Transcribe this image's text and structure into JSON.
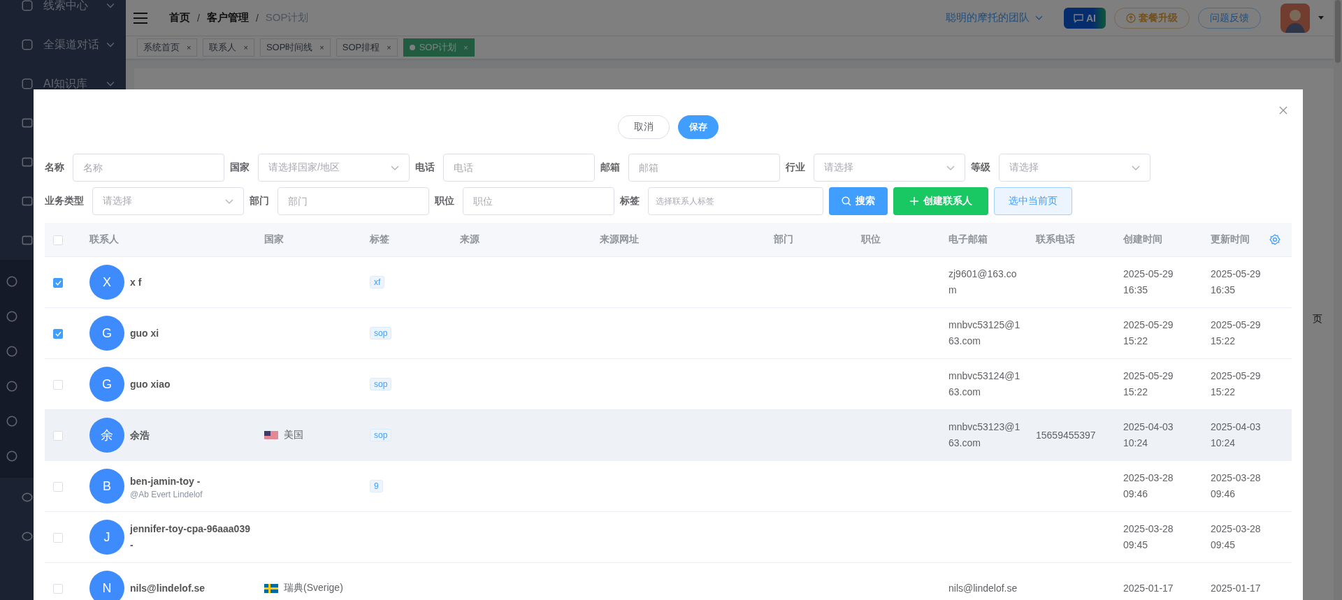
{
  "sidebar": {
    "items": [
      {
        "label": "线索中心"
      },
      {
        "label": "全渠道对话"
      },
      {
        "label": "AI知识库"
      }
    ]
  },
  "header": {
    "breadcrumb": [
      {
        "label": "首页",
        "current": false
      },
      {
        "separator": "/",
        "label": "客户管理",
        "current": false
      },
      {
        "separator": "/",
        "label": "SOP计划",
        "current": true
      }
    ],
    "team": "聪明的摩托的团队",
    "ai_button": "AI",
    "upgrade_button": "套餐升级",
    "feedback_button": "问题反馈"
  },
  "tabs": [
    {
      "label": "系统首页",
      "close": "×",
      "selected": false
    },
    {
      "label": "联系人",
      "close": "×",
      "selected": false
    },
    {
      "label": "SOP时间线",
      "close": "×",
      "selected": false
    },
    {
      "label": "SOP排程",
      "close": "×",
      "selected": false
    },
    {
      "label": "SOP计划",
      "close": "×",
      "selected": true
    }
  ],
  "background_text": "页",
  "modal": {
    "buttons": [
      {
        "label": "取消",
        "kind": "default"
      },
      {
        "label": "保存",
        "kind": "primary"
      }
    ],
    "filter_rows": [
      [
        {
          "label": "名称",
          "placeholder": "名称",
          "kind": "input"
        },
        {
          "label": "国家",
          "placeholder": "请选择国家/地区",
          "kind": "select"
        },
        {
          "label": "电话",
          "placeholder": "电话",
          "kind": "input"
        },
        {
          "label": "邮箱",
          "placeholder": "邮箱",
          "kind": "input"
        },
        {
          "label": "行业",
          "placeholder": "请选择",
          "kind": "select"
        },
        {
          "label": "等级",
          "placeholder": "请选择",
          "kind": "select"
        }
      ],
      [
        {
          "label": "业务类型",
          "placeholder": "请选择",
          "kind": "select"
        },
        {
          "label": "部门",
          "placeholder": "部门",
          "kind": "input"
        },
        {
          "label": "职位",
          "placeholder": "职位",
          "kind": "input"
        },
        {
          "label": "标签",
          "placeholder": "选择联系人标签",
          "kind": "tag"
        }
      ]
    ],
    "actions": [
      {
        "label": "搜索",
        "kind": "search"
      },
      {
        "label": "创建联系人",
        "kind": "create"
      },
      {
        "label": "选中当前页",
        "kind": "plain"
      }
    ],
    "table": {
      "header_checked": false,
      "columns": [
        "联系人",
        "国家",
        "标签",
        "来源",
        "来源网址",
        "部门",
        "职位",
        "电子邮箱",
        "联系电话",
        "创建时间",
        "更新时间"
      ],
      "rows": [
        {
          "checked": true,
          "hovered": false,
          "initial": "X",
          "name": "x f",
          "tag": "xf",
          "email": "zj9601@163.com",
          "created": [
            "2025-05-29",
            "16:35"
          ],
          "updated": [
            "2025-05-29",
            "16:35"
          ]
        },
        {
          "checked": true,
          "hovered": false,
          "initial": "G",
          "name": "guo xi",
          "tag": "sop",
          "email": "mnbvc53125@163.com",
          "created": [
            "2025-05-29",
            "15:22"
          ],
          "updated": [
            "2025-05-29",
            "15:22"
          ]
        },
        {
          "checked": false,
          "hovered": false,
          "initial": "G",
          "name": "guo xiao",
          "tag": "sop",
          "email": "mnbvc53124@163.com",
          "created": [
            "2025-05-29",
            "15:22"
          ],
          "updated": [
            "2025-05-29",
            "15:22"
          ]
        },
        {
          "checked": false,
          "hovered": true,
          "initial": "余",
          "name": "余浩",
          "country": {
            "kind": "us",
            "name": "美国"
          },
          "tag": "sop",
          "email": "mnbvc53123@163.com",
          "phone": "15659455397",
          "created": [
            "2025-04-03",
            "10:24"
          ],
          "updated": [
            "2025-04-03",
            "10:24"
          ]
        },
        {
          "checked": false,
          "hovered": false,
          "initial": "B",
          "name": "ben-jamin-toy -",
          "subtitle": "@Ab Evert Lindelof",
          "tag": "9",
          "created": [
            "2025-03-28",
            "09:46"
          ],
          "updated": [
            "2025-03-28",
            "09:46"
          ]
        },
        {
          "checked": false,
          "hovered": false,
          "initial": "J",
          "name": "jennifer-toy-cpa-96aaa039 -",
          "created": [
            "2025-03-28",
            "09:45"
          ],
          "updated": [
            "2025-03-28",
            "09:45"
          ]
        },
        {
          "checked": false,
          "hovered": false,
          "initial": "N",
          "name": "nils@lindelof.se",
          "country": {
            "kind": "se",
            "name": "瑞典(Sverige)"
          },
          "email": "nils@lindelof.se",
          "created": [
            "2025-01-17"
          ],
          "updated": [
            "2025-01-17"
          ]
        }
      ]
    }
  }
}
